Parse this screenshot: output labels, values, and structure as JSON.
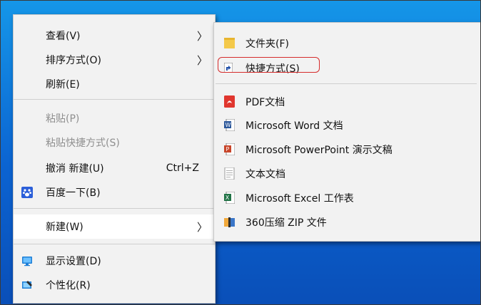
{
  "context_menu": {
    "items": [
      {
        "label": "查看(V)",
        "submenu": true
      },
      {
        "label": "排序方式(O)",
        "submenu": true
      },
      {
        "label": "刷新(E)"
      },
      {
        "label": "粘贴(P)",
        "disabled": true
      },
      {
        "label": "粘贴快捷方式(S)",
        "disabled": true
      },
      {
        "label": "撤消 新建(U)",
        "shortcut": "Ctrl+Z"
      },
      {
        "label": "百度一下(B)",
        "icon": "baidu-paw-icon"
      },
      {
        "label": "新建(W)",
        "submenu": true,
        "highlighted": true
      },
      {
        "label": "显示设置(D)",
        "icon": "display-settings-icon"
      },
      {
        "label": "个性化(R)",
        "icon": "personalize-icon"
      }
    ]
  },
  "new_submenu": {
    "items": [
      {
        "label": "文件夹(F)",
        "icon": "folder-icon"
      },
      {
        "label": "快捷方式(S)",
        "icon": "shortcut-icon",
        "annotated": true
      },
      {
        "label": "PDF文档",
        "icon": "pdf-icon"
      },
      {
        "label": "Microsoft Word 文档",
        "icon": "word-icon"
      },
      {
        "label": "Microsoft PowerPoint 演示文稿",
        "icon": "powerpoint-icon"
      },
      {
        "label": "文本文档",
        "icon": "text-doc-icon"
      },
      {
        "label": "Microsoft Excel 工作表",
        "icon": "excel-icon"
      },
      {
        "label": "360压缩 ZIP 文件",
        "icon": "zip-archive-icon"
      }
    ]
  },
  "colors": {
    "desktop": "#0b63d1",
    "menu_bg": "#f2f2f2",
    "highlight_box": "#d52b2b"
  }
}
